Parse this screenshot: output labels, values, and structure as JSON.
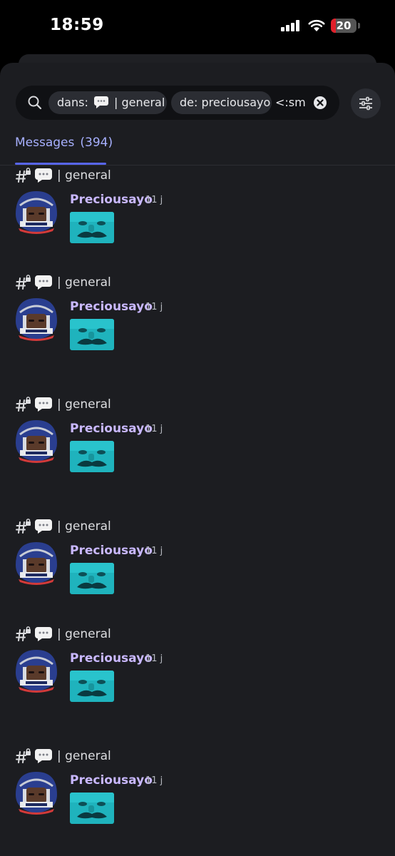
{
  "status_bar": {
    "time": "18:59",
    "battery_level": "20"
  },
  "search": {
    "chip_channel_prefix": "dans:",
    "chip_channel_name": "| general",
    "chip_author": "de: preciousayo",
    "query_text": "<:sm"
  },
  "tabs": {
    "messages_label": "Messages",
    "messages_count": "(394)"
  },
  "colors": {
    "accent": "#5865f2",
    "tab_text": "#a7b0ff",
    "author": "#c9b8ff",
    "battery_low": "#e0202a"
  },
  "results": [
    {
      "channel": "| general",
      "author": "Preciousayo",
      "time": "11 j"
    },
    {
      "channel": "| general",
      "author": "Preciousayo",
      "time": "11 j"
    },
    {
      "channel": "| general",
      "author": "Preciousayo",
      "time": "11 j"
    },
    {
      "channel": "| general",
      "author": "Preciousayo",
      "time": "11 j"
    },
    {
      "channel": "| general",
      "author": "Preciousayo",
      "time": "11 j"
    },
    {
      "channel": "| general",
      "author": "Preciousayo",
      "time": "11 j"
    }
  ]
}
